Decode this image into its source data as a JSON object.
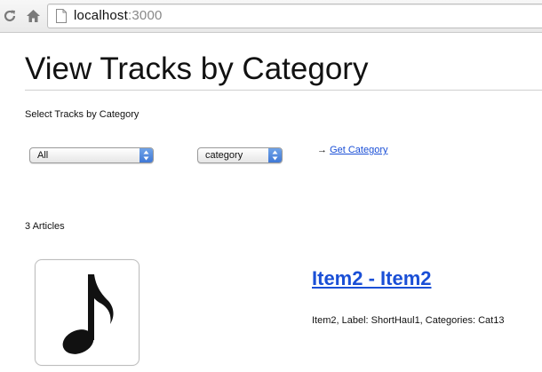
{
  "browser": {
    "url_host": "localhost",
    "url_port": ":3000",
    "icons": [
      "reload-icon",
      "home-icon",
      "page-icon"
    ]
  },
  "page": {
    "title": "View Tracks by Category",
    "select_label": "Select Tracks by Category",
    "filters": {
      "all_select_value": "All",
      "category_select_value": "category"
    },
    "get_category": {
      "arrow": "→",
      "link_label": "Get Category"
    },
    "articles_count": "3 Articles",
    "articles": [
      {
        "title": "Item2 - Item2",
        "description": "Item2, Label: ShortHaul1, Categories: Cat13",
        "thumbnail_icon": "music-note-icon"
      }
    ]
  }
}
